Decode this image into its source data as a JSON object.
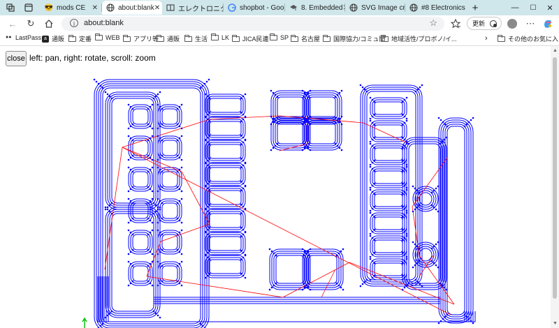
{
  "tabs": [
    {
      "title": "mods CE",
      "icon": "sunglasses-icon"
    },
    {
      "title": "about:blank",
      "icon": "globe-icon",
      "active": true
    },
    {
      "title": "エレクトロニクス",
      "icon": "book-icon"
    },
    {
      "title": "shopbot - Goo",
      "icon": "google-icon"
    },
    {
      "title": "8. Embedded",
      "icon": "cap-icon"
    },
    {
      "title": "SVG Image cre",
      "icon": "globe-icon"
    },
    {
      "title": "#8 Electronics",
      "icon": "globe-icon"
    }
  ],
  "address": {
    "url": "about:blank"
  },
  "toolbar": {
    "update_label": "更新"
  },
  "bookmarks": [
    {
      "label": "LastPass",
      "icon": "lastpass-icon"
    },
    {
      "label": "通販",
      "icon": "amazon-icon"
    },
    {
      "label": "定番",
      "icon": "folder-icon"
    },
    {
      "label": "WEB",
      "icon": "folder-icon"
    },
    {
      "label": "アプリ等",
      "icon": "folder-icon"
    },
    {
      "label": "通販",
      "icon": "folder-icon"
    },
    {
      "label": "生活",
      "icon": "folder-icon"
    },
    {
      "label": "LK",
      "icon": "folder-icon"
    },
    {
      "label": "JICA民連",
      "icon": "folder-icon"
    },
    {
      "label": "SP",
      "icon": "folder-icon"
    },
    {
      "label": "名古屋",
      "icon": "folder-icon"
    },
    {
      "label": "国際協力/コミュ関",
      "icon": "folder-icon"
    },
    {
      "label": "地域活性/プロボノ/イ...",
      "icon": "folder-icon"
    }
  ],
  "other_bookmarks": "その他のお気に入り",
  "page": {
    "close_label": "close",
    "instructions": "left: pan, right: rotate, scroll: zoom"
  },
  "colors": {
    "path": "#0000ff",
    "rapid": "#ff0000",
    "origin": "#00c000"
  }
}
